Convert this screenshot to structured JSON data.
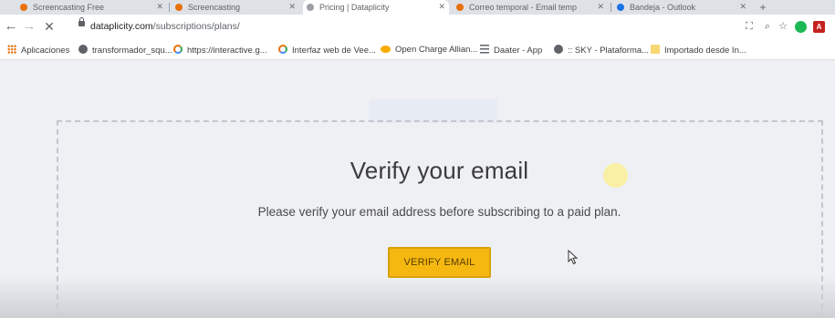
{
  "browser": {
    "tabs": [
      {
        "title": "Screencasting Free",
        "favicon_color": "#e8710a"
      },
      {
        "title": "Screencasting",
        "favicon_color": "#e8710a"
      },
      {
        "title": "Pricing | Dataplicity",
        "favicon_color": "#9aa0a6",
        "active": true
      },
      {
        "title": "Correo temporal - Email temp",
        "favicon_color": "#e8710a"
      },
      {
        "title": "Bandeja - Outlook",
        "favicon_color": "#1a73e8"
      }
    ],
    "url_host": "dataplicity.com",
    "url_path": "/subscriptions/plans/",
    "bookmarks": [
      {
        "label": "Aplicaciones",
        "icon": "apps-grid-icon"
      },
      {
        "label": "transformador_squ...",
        "icon": "globe-icon"
      },
      {
        "label": "https://interactive.g...",
        "icon": "ring-icon"
      },
      {
        "label": "Interfaz web de Vee...",
        "icon": "ring-icon"
      },
      {
        "label": "Open Charge Allian...",
        "icon": "ocpi-icon"
      },
      {
        "label": "Daater - App",
        "icon": "lines-icon"
      },
      {
        "label": ":: SKY - Plataforma...",
        "icon": "globe-icon"
      },
      {
        "label": "Importado desde In...",
        "icon": "folder-icon"
      }
    ],
    "ext_pdf_label": "A"
  },
  "page": {
    "title": "Verify your email",
    "message": "Please verify your email address before subscribing to a paid plan.",
    "button_label": "VERIFY EMAIL"
  },
  "colors": {
    "button_bg": "#f5b811",
    "page_bg": "#eef0f4"
  }
}
